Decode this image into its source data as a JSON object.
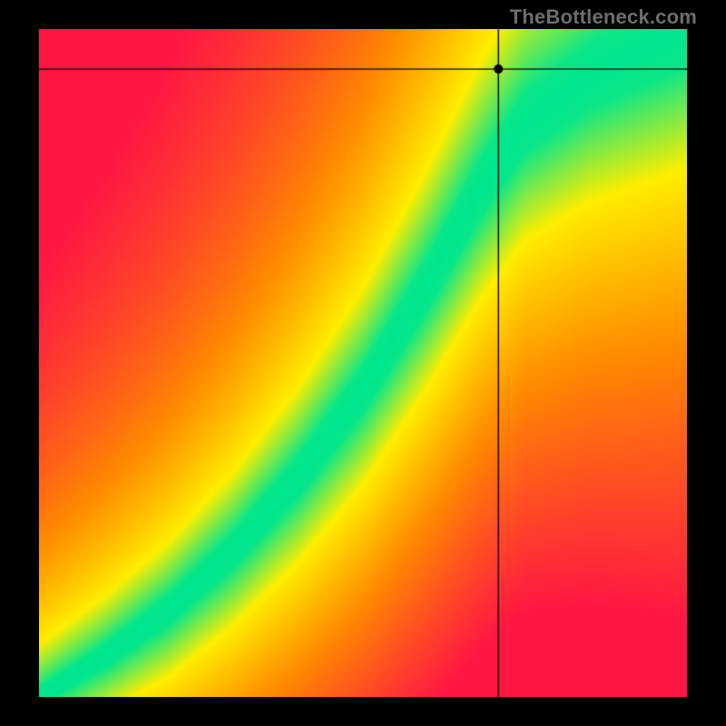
{
  "watermark": {
    "text": "TheBottleneck.com"
  },
  "chart_data": {
    "type": "heatmap",
    "title": "",
    "xlabel": "",
    "ylabel": "",
    "xlim": [
      0,
      1
    ],
    "ylim": [
      0,
      1
    ],
    "crosshair": {
      "x": 0.71,
      "y": 0.94
    },
    "marker": {
      "x": 0.71,
      "y": 0.94
    },
    "colorscale": {
      "low_match": "#ff1744",
      "mid_match": "#ffee00",
      "high_match": "#00e68f"
    },
    "ridge": {
      "description": "Green optimal-match band where GPU and CPU are balanced; curves from origin upward with a pronounced S-bend around mid-range.",
      "samples": [
        {
          "x": 0.0,
          "y": 0.0
        },
        {
          "x": 0.1,
          "y": 0.06
        },
        {
          "x": 0.2,
          "y": 0.13
        },
        {
          "x": 0.3,
          "y": 0.22
        },
        {
          "x": 0.4,
          "y": 0.33
        },
        {
          "x": 0.5,
          "y": 0.46
        },
        {
          "x": 0.6,
          "y": 0.62
        },
        {
          "x": 0.68,
          "y": 0.76
        },
        {
          "x": 0.75,
          "y": 0.86
        },
        {
          "x": 0.85,
          "y": 0.93
        },
        {
          "x": 1.0,
          "y": 1.0
        }
      ],
      "band_half_width_bottom": 0.012,
      "band_half_width_top": 0.055
    }
  }
}
